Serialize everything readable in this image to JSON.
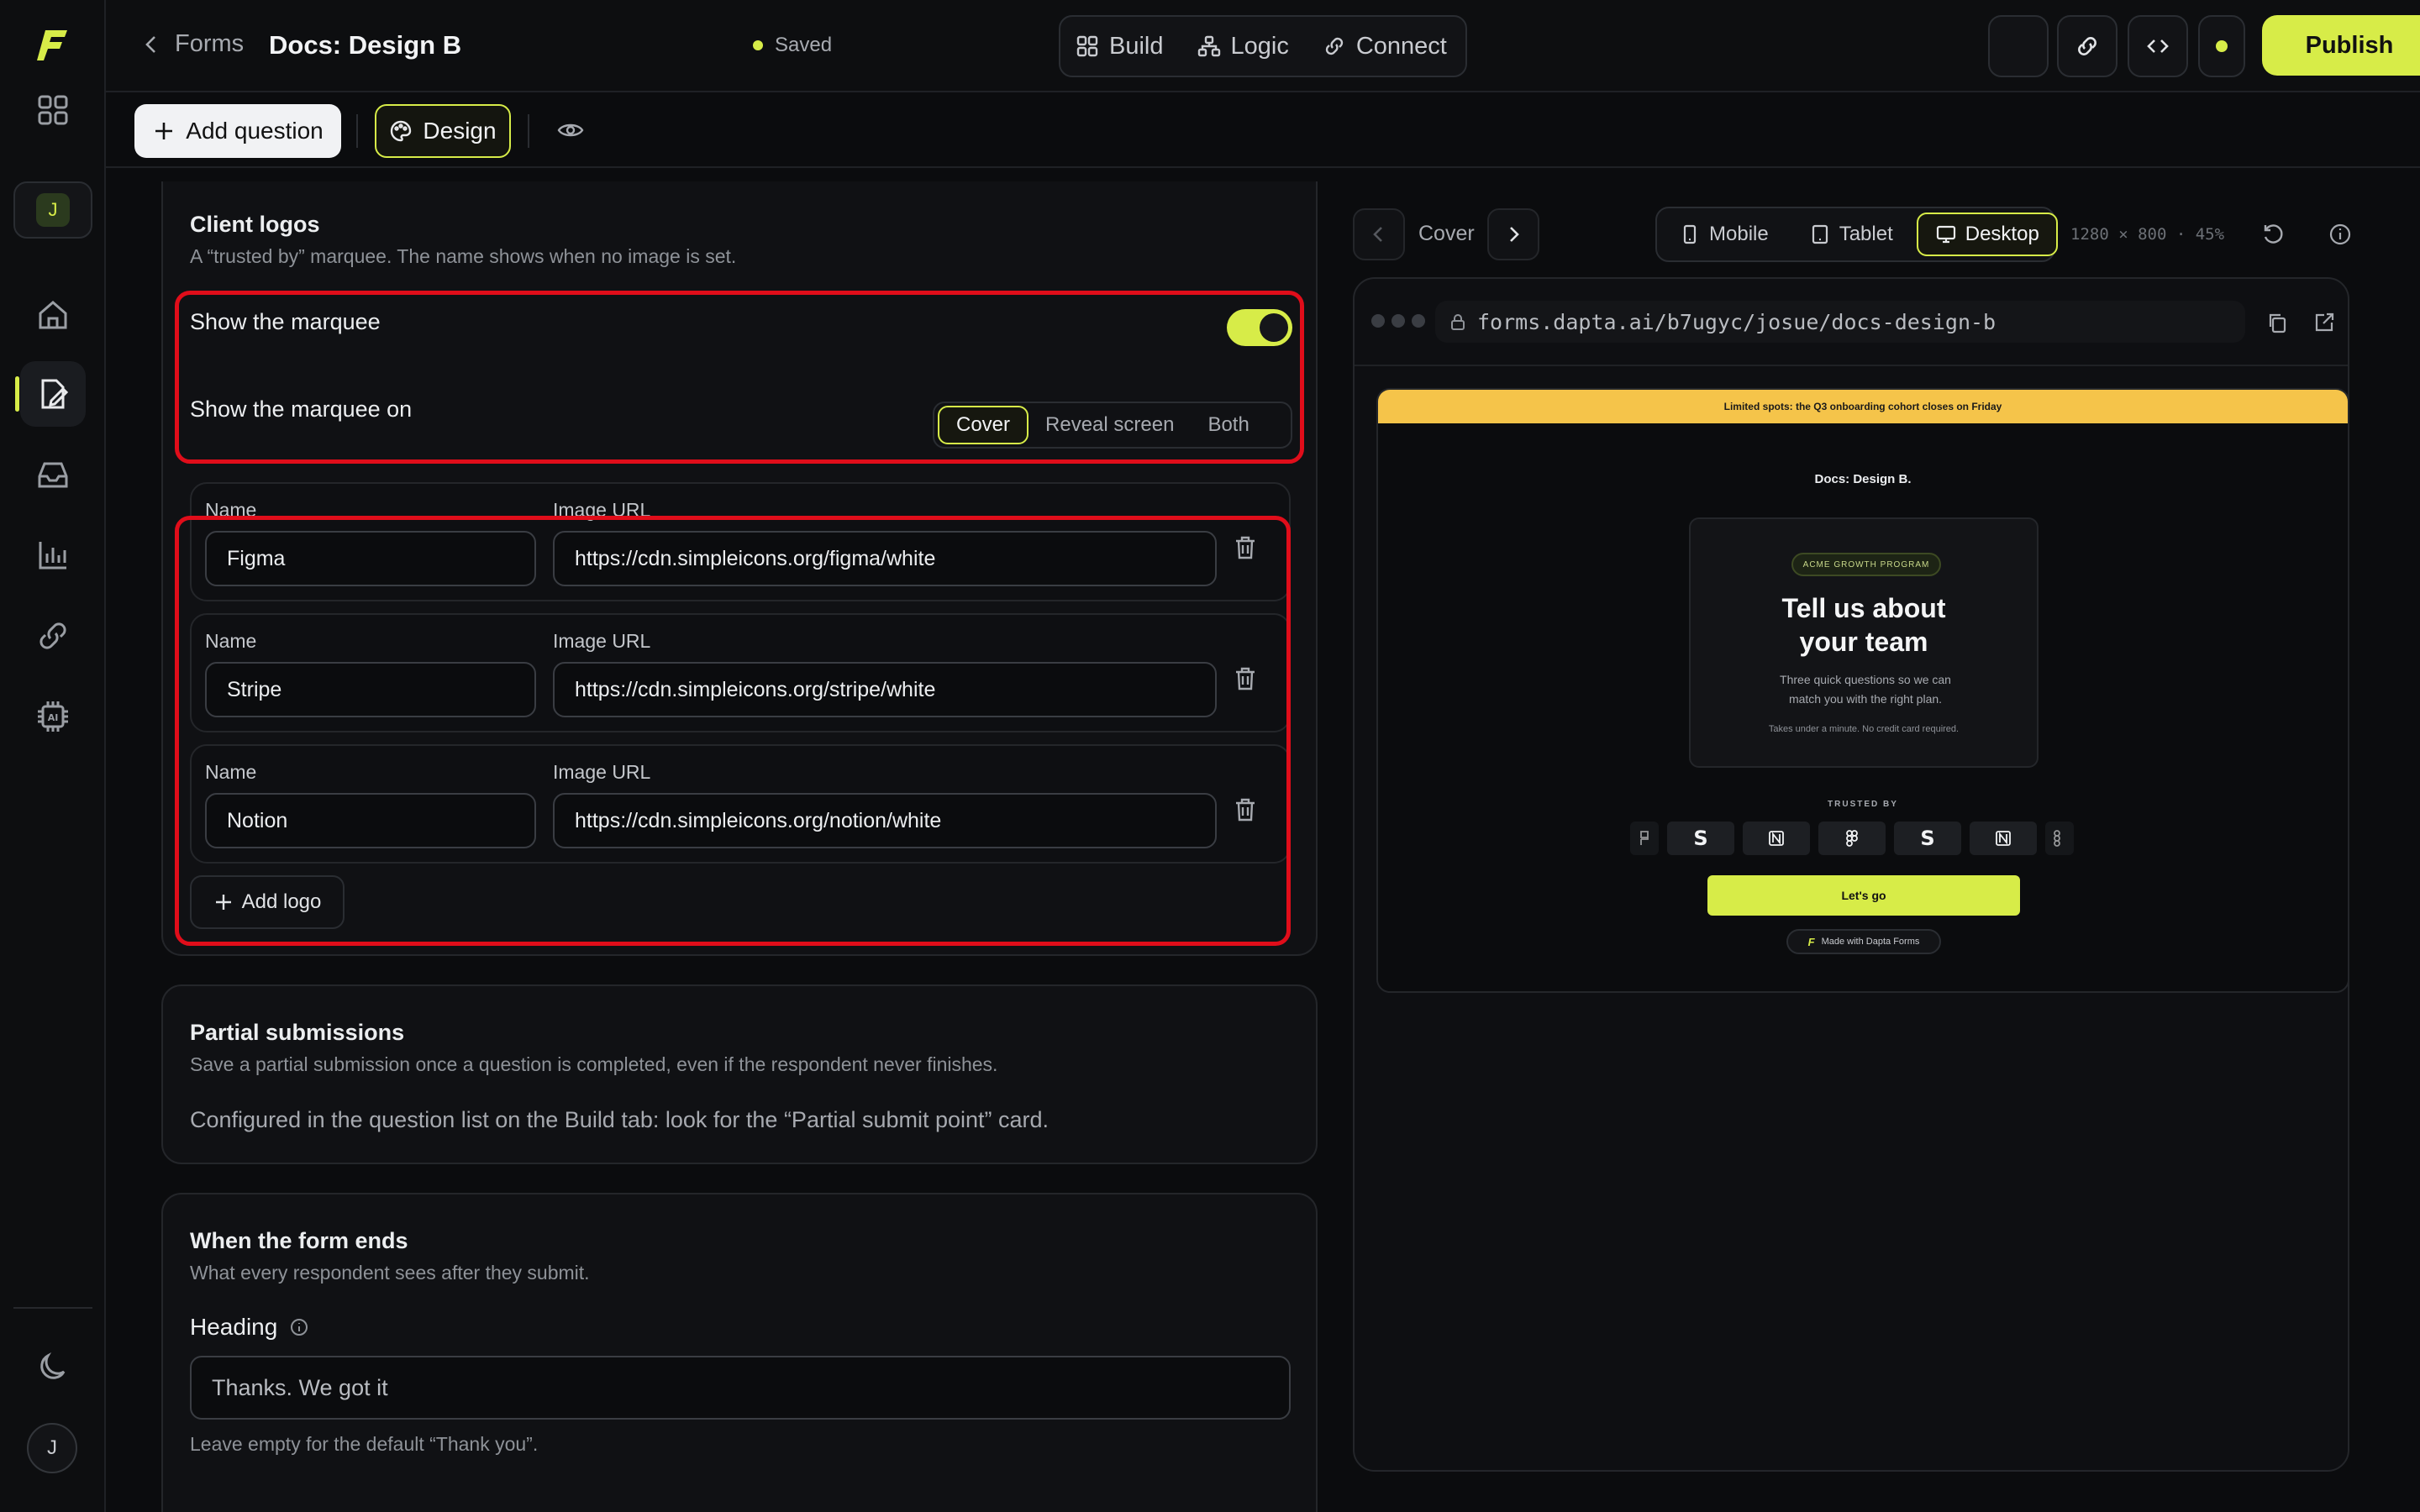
{
  "breadcrumb": {
    "back_label": "Forms"
  },
  "document": {
    "title": "Docs: Design B",
    "status": "Saved"
  },
  "modes": [
    {
      "label": "Build",
      "icon": "grid-icon"
    },
    {
      "label": "Logic",
      "icon": "flow-icon"
    },
    {
      "label": "Connect",
      "icon": "link-icon"
    }
  ],
  "actions": {
    "publish_label": "Publish"
  },
  "toolbar": {
    "add_question_label": "Add question",
    "design_label": "Design"
  },
  "sidebar": {
    "workspace_initial": "J",
    "user_initial": "J"
  },
  "client_logos": {
    "title": "Client logos",
    "subtitle": "A “trusted by” marquee. The name shows when no image is set.",
    "show_marquee_label": "Show the marquee",
    "show_marquee_enabled": true,
    "show_on_label": "Show the marquee on",
    "show_on_options": [
      "Cover",
      "Reveal screen",
      "Both"
    ],
    "show_on_selected": "Cover",
    "name_label": "Name",
    "url_label": "Image URL",
    "logos": [
      {
        "name": "Figma",
        "url": "https://cdn.simpleicons.org/figma/white"
      },
      {
        "name": "Stripe",
        "url": "https://cdn.simpleicons.org/stripe/white"
      },
      {
        "name": "Notion",
        "url": "https://cdn.simpleicons.org/notion/white"
      }
    ],
    "add_logo_label": "Add logo"
  },
  "partial": {
    "title": "Partial submissions",
    "subtitle": "Save a partial submission once a question is completed, even if the respondent never finishes.",
    "note": "Configured in the question list on the Build tab: look for the “Partial submit point” card."
  },
  "form_end": {
    "title": "When the form ends",
    "subtitle": "What every respondent sees after they submit.",
    "heading_label": "Heading",
    "heading_value": "Thanks. We got it",
    "heading_hint": "Leave empty for the default “Thank you”."
  },
  "preview": {
    "screen_label": "Cover",
    "devices": [
      "Mobile",
      "Tablet",
      "Desktop"
    ],
    "device_selected": "Desktop",
    "dimensions": "1280 × 800 · 45%",
    "url": "forms.dapta.ai/b7ugyc/josue/docs-design-b",
    "banner": "Limited spots: the Q3 onboarding cohort closes on Friday",
    "site_title": "Docs: Design B.",
    "pill": "ACME GROWTH PROGRAM",
    "headline_1": "Tell us about",
    "headline_2": "your team",
    "lede_1": "Three quick questions so we can",
    "lede_2": "match you with the right plan.",
    "fineprint": "Takes under a minute. No credit card required.",
    "trusted_by": "TRUSTED BY",
    "cta": "Let's go",
    "made_with": "Made with Dapta Forms"
  },
  "colors": {
    "accent": "#d7ec48",
    "highlight": "#e00d1a",
    "banner": "#f5c44a"
  }
}
